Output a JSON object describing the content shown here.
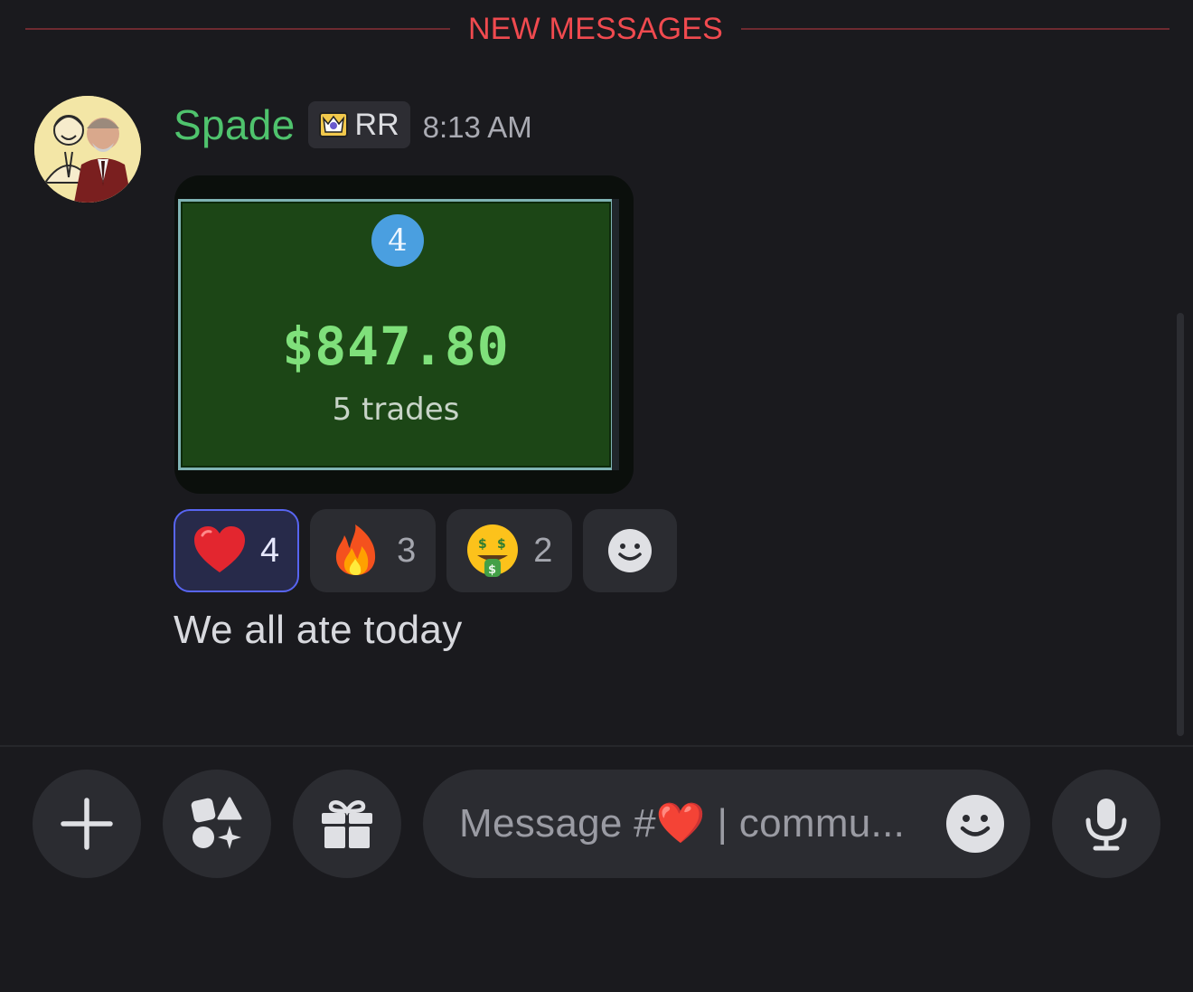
{
  "divider": {
    "label": "NEW MESSAGES"
  },
  "message": {
    "author": "Spade",
    "role_tag": "RR",
    "timestamp": "8:13 AM",
    "attachment": {
      "rank": "4",
      "amount": "$847.80",
      "subtitle": "5 trades"
    },
    "reactions": [
      {
        "emoji": "red-heart",
        "count": "4",
        "active": true
      },
      {
        "emoji": "fire",
        "count": "3",
        "active": false
      },
      {
        "emoji": "money-mouth-face",
        "count": "2",
        "active": false
      }
    ],
    "text": "We all ate today"
  },
  "composer": {
    "placeholder": "Message #❤️ | commu..."
  },
  "colors": {
    "background": "#1a1a1e",
    "username": "#4fc36d",
    "new_messages": "#f04a4f",
    "active_reaction_border": "#5865f2"
  }
}
